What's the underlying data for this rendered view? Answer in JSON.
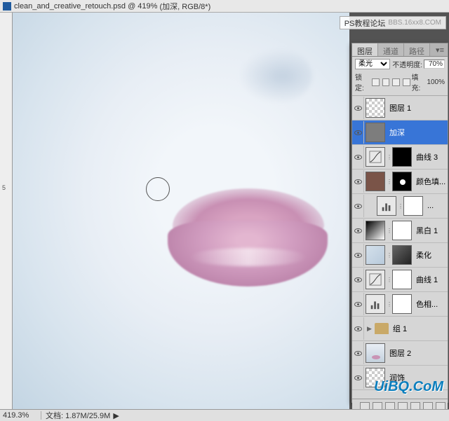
{
  "title": {
    "filename": "clean_and_creative_retouch.psd",
    "zoom_pct": "419%",
    "mode": "(加深, RGB/8*)"
  },
  "ruler": {
    "mark5": "5"
  },
  "watermarks": {
    "forum": "PS教程论坛",
    "forum_url": "BBS.16xx8.COM",
    "logo": "UiBQ.CoM"
  },
  "panel": {
    "tabs": {
      "layers": "图层",
      "channels": "通道",
      "paths": "路径"
    },
    "blend_mode": "柔光",
    "opacity_label": "不透明度:",
    "opacity_value": "70%",
    "lock_label": "锁定:",
    "fill_label": "填充:",
    "fill_value": "100%"
  },
  "layers": [
    {
      "name": "图层 1",
      "type": "pixel-transparent"
    },
    {
      "name": "加深",
      "type": "pixel-gray",
      "selected": true
    },
    {
      "name": "曲线 3",
      "type": "curves",
      "mask": "black"
    },
    {
      "name": "颜色填...",
      "type": "fill-brown",
      "mask": "dot"
    },
    {
      "name": "...",
      "type": "levels-indent",
      "mask": "white"
    },
    {
      "name": "黑白 1",
      "type": "grad-bw",
      "mask": "white"
    },
    {
      "name": "柔化",
      "type": "face-dual"
    },
    {
      "name": "曲线 1",
      "type": "curves",
      "mask": "white"
    },
    {
      "name": "色相...",
      "type": "levels",
      "mask": "white"
    },
    {
      "name": "组 1",
      "type": "group"
    },
    {
      "name": "图层 2",
      "type": "face"
    },
    {
      "name": "润饰",
      "type": "pixel-transparent"
    }
  ],
  "status": {
    "zoom": "419.3%",
    "doc_label": "文档:",
    "doc_size": "1.87M/25.9M"
  }
}
